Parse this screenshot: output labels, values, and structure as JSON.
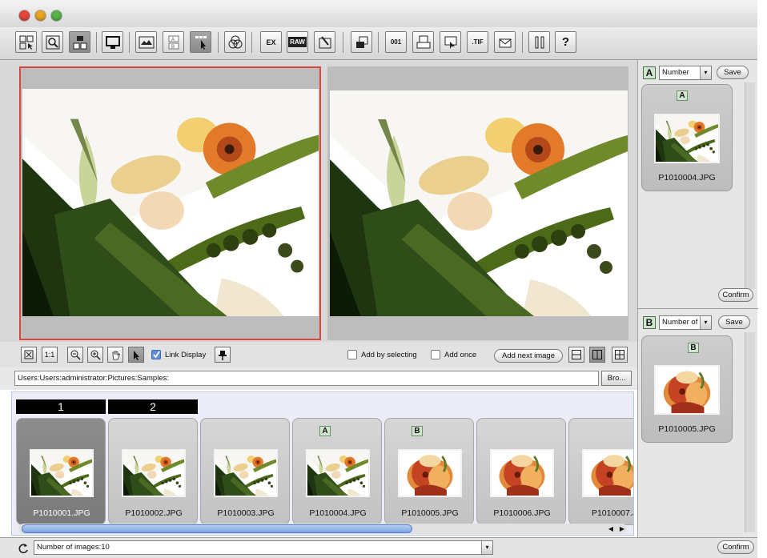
{
  "toolbar": {
    "icons": [
      "thumbnail-view-icon",
      "preview-view-icon",
      "split-view-icon",
      "monitor-icon",
      "filmstrip-icon",
      "compare-ab-icon",
      "select-mode-icon",
      "color-adjust-icon",
      "exif-icon",
      "raw-icon",
      "edit-icon",
      "file-info-icon",
      "rename-icon",
      "print-icon",
      "slideshow-icon",
      "convert-icon",
      "mail-icon",
      "tools-icon",
      "help-icon"
    ],
    "exif_label": "EX",
    "raw_label": "RAW",
    "rename_label": "001",
    "convert_label": ".TIF",
    "help_label": "?"
  },
  "controls": {
    "link_display_label": "Link Display",
    "add_by_selecting_label": "Add by selecting",
    "add_once_label": "Add once",
    "add_next_image_label": "Add next image",
    "fit_label": "1:1"
  },
  "path": {
    "value": "Users:Users:administrator:Pictures:Samples:",
    "browse_label": "Bro..."
  },
  "strip": {
    "column_headers": [
      "1",
      "2"
    ],
    "thumbnails": [
      {
        "label": "P1010001.JPG",
        "badge": "",
        "kind": "veg",
        "selected": true
      },
      {
        "label": "P1010002.JPG",
        "badge": "",
        "kind": "veg",
        "selected": false
      },
      {
        "label": "P1010003.JPG",
        "badge": "",
        "kind": "veg",
        "selected": false
      },
      {
        "label": "P1010004.JPG",
        "badge": "A",
        "kind": "veg",
        "selected": false
      },
      {
        "label": "P1010005.JPG",
        "badge": "B",
        "kind": "fruit",
        "selected": false
      },
      {
        "label": "P1010006.JPG",
        "badge": "",
        "kind": "fruit",
        "selected": false
      },
      {
        "label": "P1010007.J",
        "badge": "",
        "kind": "fruit",
        "selected": false
      }
    ]
  },
  "status": {
    "count_text": "Number of images:10"
  },
  "right_panel": {
    "group_a": {
      "letter": "A",
      "select_value": "Number",
      "save_label": "Save",
      "card_badge": "A",
      "card_label": "P1010004.JPG",
      "confirm_label": "Confirm"
    },
    "group_b": {
      "letter": "B",
      "select_value": "Number of",
      "save_label": "Save",
      "card_badge": "B",
      "card_label": "P1010005.JPG",
      "confirm_label": "Confirm"
    }
  },
  "colors": {
    "selection_border": "#d9463d",
    "scrollbar": "#8fb0ea",
    "badge_fill": "#d0e6cf"
  }
}
